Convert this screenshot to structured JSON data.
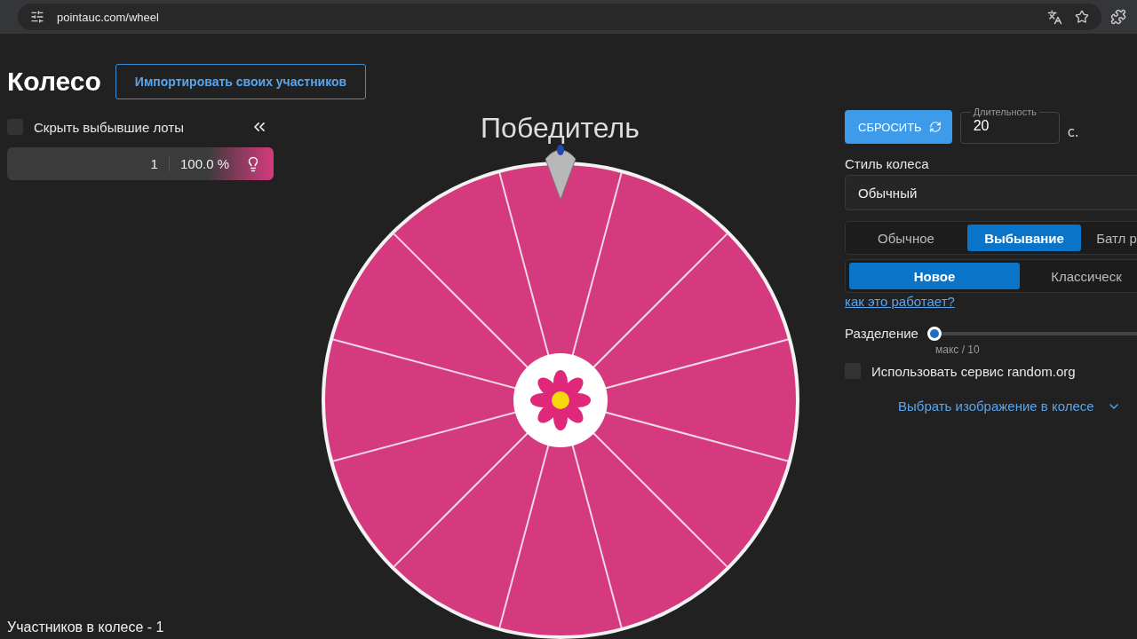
{
  "browser": {
    "url": "pointauc.com/wheel"
  },
  "header": {
    "title": "Колесо",
    "import_button": "Импортировать своих участников"
  },
  "left": {
    "hide_eliminated": {
      "label": "Скрыть выбывшие лоты",
      "checked": false
    },
    "lots": [
      {
        "amount": "1",
        "percent": "100.0 %",
        "color": "#d63a7e"
      }
    ],
    "participants_count": "Участников в колесе - 1"
  },
  "wheel": {
    "title": "Победитель"
  },
  "controls": {
    "reset_button": "СБРОСИТЬ",
    "duration": {
      "label": "Длительность",
      "value": "20",
      "unit": "с."
    },
    "wheel_style": {
      "label": "Стиль колеса",
      "value": "Обычный"
    },
    "modes": [
      {
        "label": "Обычное",
        "selected": false
      },
      {
        "label": "Выбывание",
        "selected": true
      },
      {
        "label": "Батл р",
        "selected": false
      }
    ],
    "variants": [
      {
        "label": "Новое",
        "selected": true
      },
      {
        "label": "Классическ",
        "selected": false
      }
    ],
    "help_link": "как это работает?",
    "split": {
      "label": "Разделение",
      "level": 0,
      "caption": "макс / 10"
    },
    "random_org": {
      "label": "Использовать сервис random.org",
      "checked": false
    },
    "image_picker": "Выбрать изображение в колесе"
  }
}
